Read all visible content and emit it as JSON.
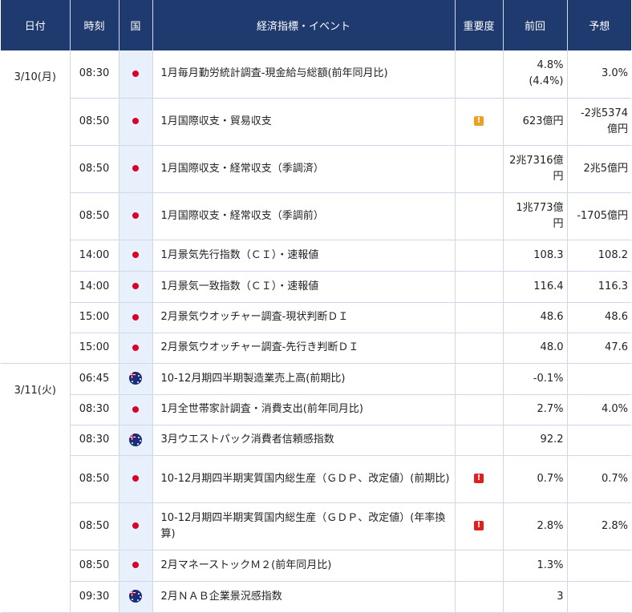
{
  "headers": {
    "date": "日付",
    "time": "時刻",
    "country": "国",
    "event": "経済指標・イベント",
    "importance": "重要度",
    "previous": "前回",
    "forecast": "予想"
  },
  "days": [
    {
      "date": "3/10(月)",
      "rows": [
        {
          "time": "08:30",
          "country": "jp",
          "event": "1月毎月勤労統計調査-現金給与総額(前年同月比)",
          "importance": "",
          "previous": "4.8%",
          "previous_sub": "(4.4%)",
          "forecast": "3.0%",
          "height": 59
        },
        {
          "time": "08:50",
          "country": "jp",
          "event": "1月国際収支・貿易収支",
          "importance": "medium",
          "previous": "623億円",
          "previous_sub": "",
          "forecast": "-2兆5374億円",
          "height": 59
        },
        {
          "time": "08:50",
          "country": "jp",
          "event": "1月国際収支・経常収支（季調済）",
          "importance": "",
          "previous": "2兆7316億円",
          "previous_sub": "",
          "forecast": "2兆5億円",
          "height": 59
        },
        {
          "time": "08:50",
          "country": "jp",
          "event": "1月国際収支・経常収支（季調前）",
          "importance": "",
          "previous": "1兆773億円",
          "previous_sub": "",
          "forecast": "-1705億円",
          "height": 59
        },
        {
          "time": "14:00",
          "country": "jp",
          "event": "1月景気先行指数（ＣＩ）・速報値",
          "importance": "",
          "previous": "108.3",
          "previous_sub": "",
          "forecast": "108.2",
          "height": 39
        },
        {
          "time": "14:00",
          "country": "jp",
          "event": "1月景気一致指数（ＣＩ）・速報値",
          "importance": "",
          "previous": "116.4",
          "previous_sub": "",
          "forecast": "116.3",
          "height": 39
        },
        {
          "time": "15:00",
          "country": "jp",
          "event": "2月景気ウオッチャー調査-現状判断ＤＩ",
          "importance": "",
          "previous": "48.6",
          "previous_sub": "",
          "forecast": "48.6",
          "height": 38
        },
        {
          "time": "15:00",
          "country": "jp",
          "event": "2月景気ウオッチャー調査-先行き判断ＤＩ",
          "importance": "",
          "previous": "48.0",
          "previous_sub": "",
          "forecast": "47.6",
          "height": 38
        }
      ]
    },
    {
      "date": "3/11(火)",
      "rows": [
        {
          "time": "06:45",
          "country": "au",
          "event": "10-12月期四半期製造業売上高(前期比)",
          "importance": "",
          "previous": "-0.1%",
          "previous_sub": "",
          "forecast": "",
          "height": 39
        },
        {
          "time": "08:30",
          "country": "jp",
          "event": "1月全世帯家計調査・消費支出(前年同月比)",
          "importance": "",
          "previous": "2.7%",
          "previous_sub": "",
          "forecast": "4.0%",
          "height": 38
        },
        {
          "time": "08:30",
          "country": "au",
          "event": "3月ウエストパック消費者信頼感指数",
          "importance": "",
          "previous": "92.2",
          "previous_sub": "",
          "forecast": "",
          "height": 38
        },
        {
          "time": "08:50",
          "country": "jp",
          "event": "10-12月期四半期実質国内総生産（ＧＤＰ、改定値）(前期比)",
          "importance": "high",
          "previous": "0.7%",
          "previous_sub": "",
          "forecast": "0.7%",
          "height": 59
        },
        {
          "time": "08:50",
          "country": "jp",
          "event": "10-12月期四半期実質国内総生産（ＧＤＰ、改定値）(年率換算)",
          "importance": "high",
          "previous": "2.8%",
          "previous_sub": "",
          "forecast": "2.8%",
          "height": 59
        },
        {
          "time": "08:50",
          "country": "jp",
          "event": "2月マネーストックＭ２(前年同月比)",
          "importance": "",
          "previous": "1.3%",
          "previous_sub": "",
          "forecast": "",
          "height": 39
        },
        {
          "time": "09:30",
          "country": "au",
          "event": "2月ＮＡＢ企業景況感指数",
          "importance": "",
          "previous": "3",
          "previous_sub": "",
          "forecast": "",
          "height": 39
        }
      ]
    }
  ],
  "colors": {
    "header_bg": "#1f3a6e",
    "flag_col_bg": "#e8f1fb",
    "importance_medium": "#f0a020",
    "importance_high": "#e02020"
  }
}
